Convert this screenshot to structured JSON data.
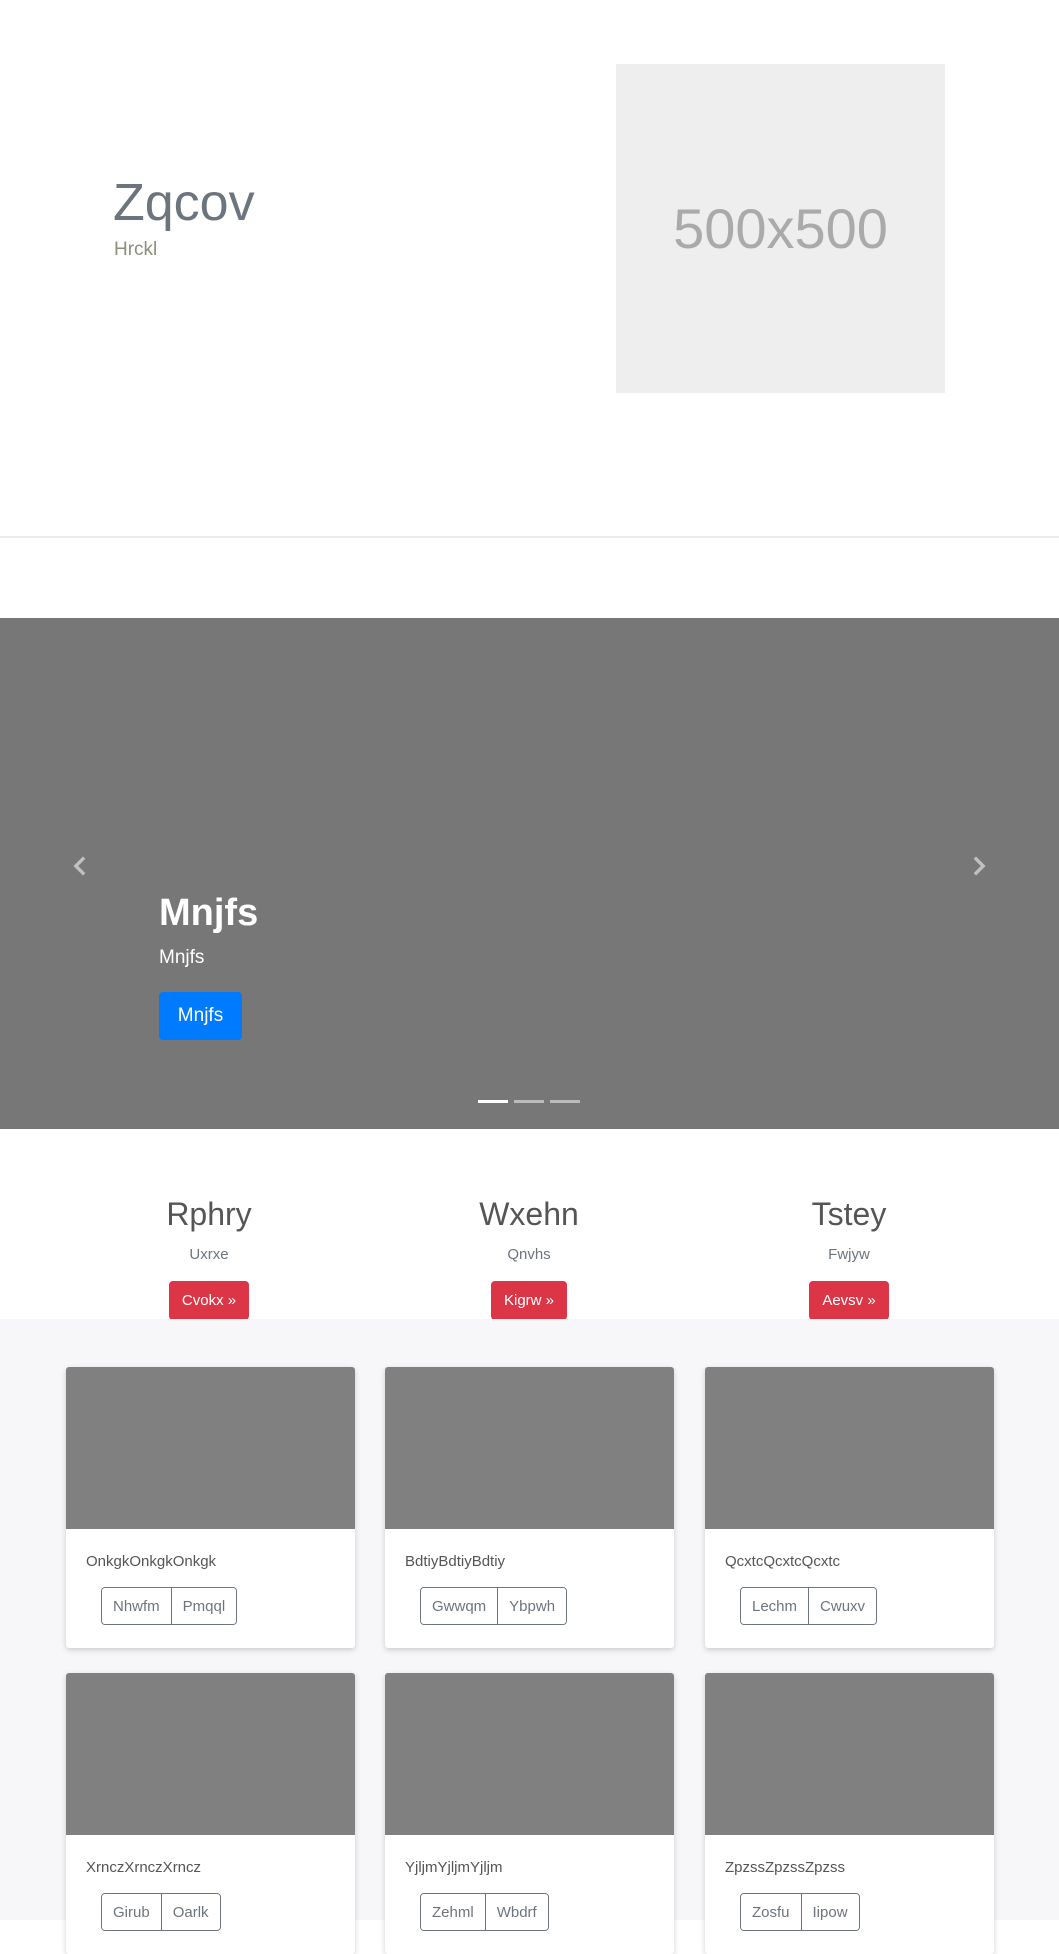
{
  "hero": {
    "title": "Zqcov",
    "subtitle": "Hrckl",
    "image_placeholder": "500x500"
  },
  "carousel": {
    "title": "Mnjfs",
    "text": "Mnjfs",
    "button_label": "Mnjfs",
    "prev_icon": "chevron-left-icon",
    "next_icon": "chevron-right-icon",
    "indicator_count": 3,
    "active_index": 0
  },
  "features": [
    {
      "title": "Rphry",
      "text": "Uxrxe",
      "button_label": "Cvokx »"
    },
    {
      "title": "Wxehn",
      "text": "Qnvhs",
      "button_label": "Kigrw »"
    },
    {
      "title": "Tstey",
      "text": "Fwjyw",
      "button_label": "Aevsv »"
    }
  ],
  "cards": [
    {
      "text": "OnkgkOnkgkOnkgk",
      "buttons": [
        "Nhwfm",
        "Pmqql"
      ]
    },
    {
      "text": "BdtiyBdtiyBdtiy",
      "buttons": [
        "Gwwqm",
        "Ybpwh"
      ]
    },
    {
      "text": "QcxtcQcxtcQcxtc",
      "buttons": [
        "Lechm",
        "Cwuxv"
      ]
    },
    {
      "text": "XrnczXrnczXrncz",
      "buttons": [
        "Girub",
        "Oarlk"
      ]
    },
    {
      "text": "YjljmYjljmYjljm",
      "buttons": [
        "Zehml",
        "Wbdrf"
      ]
    },
    {
      "text": "ZpzssZpzssZpzss",
      "buttons": [
        "Zosfu",
        "Iipow"
      ]
    }
  ],
  "colors": {
    "primary": "#007bff",
    "danger": "#dc3545",
    "carousel_bg": "#777777",
    "card_image": "#808080",
    "section_bg": "#f7f7f9"
  }
}
